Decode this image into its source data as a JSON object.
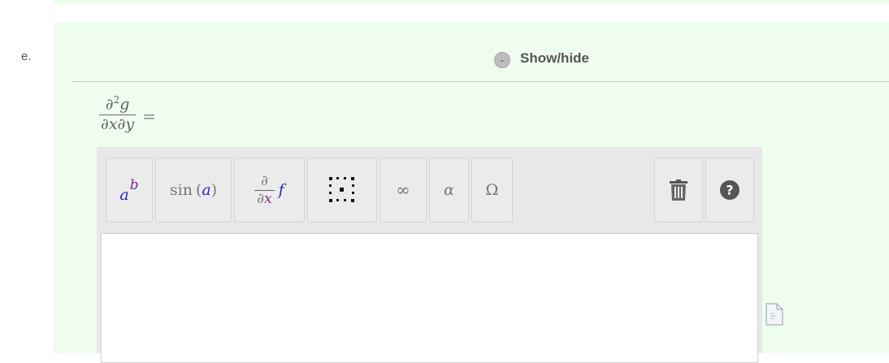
{
  "question": {
    "part_label": "e.",
    "toggle_symbol": "-",
    "toggle_label": "Show/hide"
  },
  "expression": {
    "numerator": "∂",
    "numerator_power": "2",
    "numerator_var": "g",
    "denominator": "∂x∂y",
    "relation": "="
  },
  "toolbar": {
    "power": {
      "base": "a",
      "exponent": "b"
    },
    "function": {
      "name": "sin",
      "open": "(",
      "arg": "a",
      "close": ")"
    },
    "derivative": {
      "num": "∂",
      "den_d": "∂",
      "den_var": "x",
      "func": "f"
    },
    "infinity": "∞",
    "greek": "α",
    "symbols": "Ω",
    "help": "?"
  },
  "colors": {
    "panel_bg": "#effdef",
    "toolbar_bg": "#e8e8e8",
    "var_blue": "#2929c8",
    "var_purple": "#7a2b8b"
  },
  "icons": {
    "matrix": "matrix-icon",
    "delete": "trash-icon",
    "help": "help-circle-icon",
    "file": "file-icon"
  }
}
